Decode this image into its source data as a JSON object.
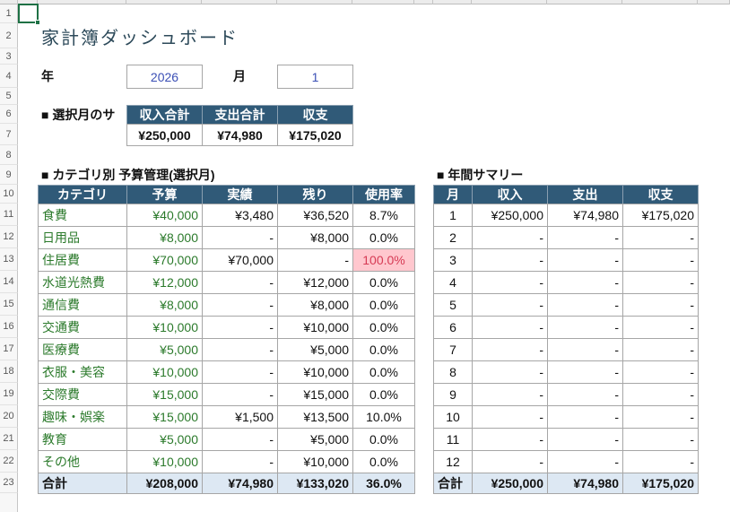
{
  "colors": {
    "table_header_bg": "#305a78",
    "total_row_bg": "#dde8f3",
    "budget_text": "#2b7a2b",
    "over_budget_bg": "#ffc7ce",
    "over_budget_text": "#d63a54",
    "input_text": "#3b4fb5",
    "title_text": "#2d4a5a",
    "selection": "#1e7145"
  },
  "sheet": {
    "row_numbers": [
      "1",
      "2",
      "3",
      "4",
      "5",
      "6",
      "7",
      "8",
      "9",
      "10",
      "11",
      "12",
      "13",
      "14",
      "15",
      "16",
      "17",
      "18",
      "19",
      "20",
      "21",
      "22",
      "23"
    ],
    "title": "家計簿ダッシュボード",
    "period": {
      "year_label": "年",
      "year": "2026",
      "month_label": "月",
      "month": "1"
    },
    "monthly_summary": {
      "heading": "■ 選択月のサ",
      "columns": [
        "収入合計",
        "支出合計",
        "収支"
      ],
      "values": [
        "¥250,000",
        "¥74,980",
        "¥175,020"
      ]
    },
    "category_budget": {
      "heading": "■ カテゴリ別 予算管理(選択月)",
      "columns": [
        "カテゴリ",
        "予算",
        "実績",
        "残り",
        "使用率"
      ],
      "rows": [
        {
          "category": "食費",
          "budget": "¥40,000",
          "actual": "¥3,480",
          "remaining": "¥36,520",
          "usage_rate": "8.7%"
        },
        {
          "category": "日用品",
          "budget": "¥8,000",
          "actual": "-",
          "remaining": "¥8,000",
          "usage_rate": "0.0%"
        },
        {
          "category": "住居費",
          "budget": "¥70,000",
          "actual": "¥70,000",
          "remaining": "-",
          "usage_rate": "100.0%",
          "over_budget": true
        },
        {
          "category": "水道光熱費",
          "budget": "¥12,000",
          "actual": "-",
          "remaining": "¥12,000",
          "usage_rate": "0.0%"
        },
        {
          "category": "通信費",
          "budget": "¥8,000",
          "actual": "-",
          "remaining": "¥8,000",
          "usage_rate": "0.0%"
        },
        {
          "category": "交通費",
          "budget": "¥10,000",
          "actual": "-",
          "remaining": "¥10,000",
          "usage_rate": "0.0%"
        },
        {
          "category": "医療費",
          "budget": "¥5,000",
          "actual": "-",
          "remaining": "¥5,000",
          "usage_rate": "0.0%"
        },
        {
          "category": "衣服・美容",
          "budget": "¥10,000",
          "actual": "-",
          "remaining": "¥10,000",
          "usage_rate": "0.0%"
        },
        {
          "category": "交際費",
          "budget": "¥15,000",
          "actual": "-",
          "remaining": "¥15,000",
          "usage_rate": "0.0%"
        },
        {
          "category": "趣味・娯楽",
          "budget": "¥15,000",
          "actual": "¥1,500",
          "remaining": "¥13,500",
          "usage_rate": "10.0%"
        },
        {
          "category": "教育",
          "budget": "¥5,000",
          "actual": "-",
          "remaining": "¥5,000",
          "usage_rate": "0.0%"
        },
        {
          "category": "その他",
          "budget": "¥10,000",
          "actual": "-",
          "remaining": "¥10,000",
          "usage_rate": "0.0%"
        }
      ],
      "total": {
        "label": "合計",
        "budget": "¥208,000",
        "actual": "¥74,980",
        "remaining": "¥133,020",
        "usage_rate": "36.0%"
      }
    },
    "annual_summary": {
      "heading": "■ 年間サマリー",
      "columns": [
        "月",
        "収入",
        "支出",
        "収支"
      ],
      "rows": [
        {
          "month": "1",
          "income": "¥250,000",
          "expense": "¥74,980",
          "balance": "¥175,020"
        },
        {
          "month": "2",
          "income": "-",
          "expense": "-",
          "balance": "-"
        },
        {
          "month": "3",
          "income": "-",
          "expense": "-",
          "balance": "-"
        },
        {
          "month": "4",
          "income": "-",
          "expense": "-",
          "balance": "-"
        },
        {
          "month": "5",
          "income": "-",
          "expense": "-",
          "balance": "-"
        },
        {
          "month": "6",
          "income": "-",
          "expense": "-",
          "balance": "-"
        },
        {
          "month": "7",
          "income": "-",
          "expense": "-",
          "balance": "-"
        },
        {
          "month": "8",
          "income": "-",
          "expense": "-",
          "balance": "-"
        },
        {
          "month": "9",
          "income": "-",
          "expense": "-",
          "balance": "-"
        },
        {
          "month": "10",
          "income": "-",
          "expense": "-",
          "balance": "-"
        },
        {
          "month": "11",
          "income": "-",
          "expense": "-",
          "balance": "-"
        },
        {
          "month": "12",
          "income": "-",
          "expense": "-",
          "balance": "-"
        }
      ],
      "total": {
        "label": "合計",
        "income": "¥250,000",
        "expense": "¥74,980",
        "balance": "¥175,020"
      }
    }
  }
}
